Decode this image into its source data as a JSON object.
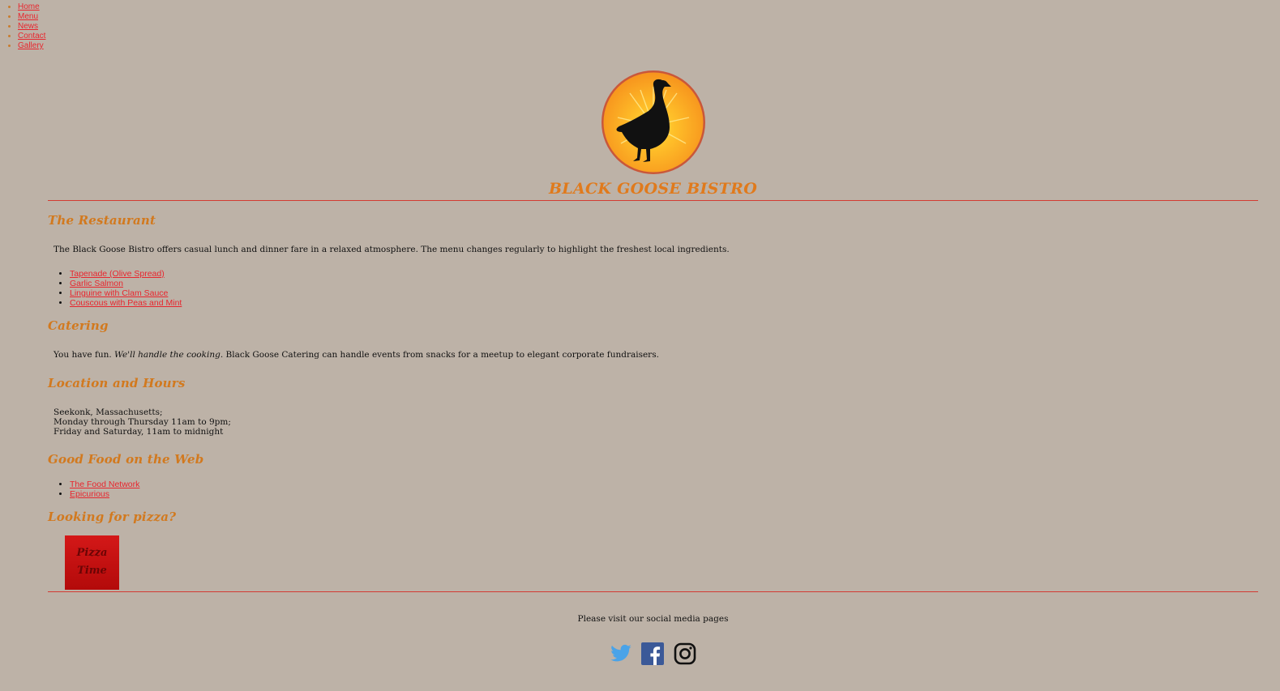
{
  "nav": {
    "items": [
      {
        "label": "Home"
      },
      {
        "label": "Menu"
      },
      {
        "label": "News"
      },
      {
        "label": "Contact"
      },
      {
        "label": "Gallery"
      }
    ]
  },
  "header": {
    "title": "BLACK GOOSE BISTRO",
    "logo_icon": "goose-sunburst-logo"
  },
  "restaurant": {
    "heading": "The Restaurant",
    "text": "The Black Goose Bistro offers casual lunch and dinner fare in a relaxed atmosphere. The menu changes regularly to highlight the freshest local ingredients.",
    "menu_items": [
      {
        "label": "Tapenade (Olive Spread)"
      },
      {
        "label": "Garlic Salmon"
      },
      {
        "label": "Linguine with Clam Sauce"
      },
      {
        "label": "Couscous with Peas and Mint"
      }
    ]
  },
  "catering": {
    "heading": "Catering",
    "text_start": "You have fun. ",
    "text_em": "We'll handle the cooking",
    "text_end": ". Black Goose Catering can handle events from snacks for a meetup to elegant corporate fundraisers."
  },
  "location": {
    "heading": "Location and Hours",
    "lines": [
      "Seekonk, Massachusetts;",
      "Monday through Thursday 11am to 9pm;",
      "Friday and Saturday, 11am to midnight"
    ]
  },
  "web": {
    "heading": "Good Food on the Web",
    "links": [
      {
        "label": "The Food Network"
      },
      {
        "label": "Epicurious"
      }
    ]
  },
  "pizza": {
    "heading": "Looking for pizza?",
    "badge_line1": "Pizza",
    "badge_line2": "Time"
  },
  "footer": {
    "social_text": "Please visit our social media pages",
    "icons": [
      "twitter-icon",
      "facebook-icon",
      "instagram-icon"
    ]
  },
  "colors": {
    "background": "#bdb2a7",
    "accent": "#d2791e",
    "link": "#e8262e",
    "rule": "#d33b32"
  }
}
